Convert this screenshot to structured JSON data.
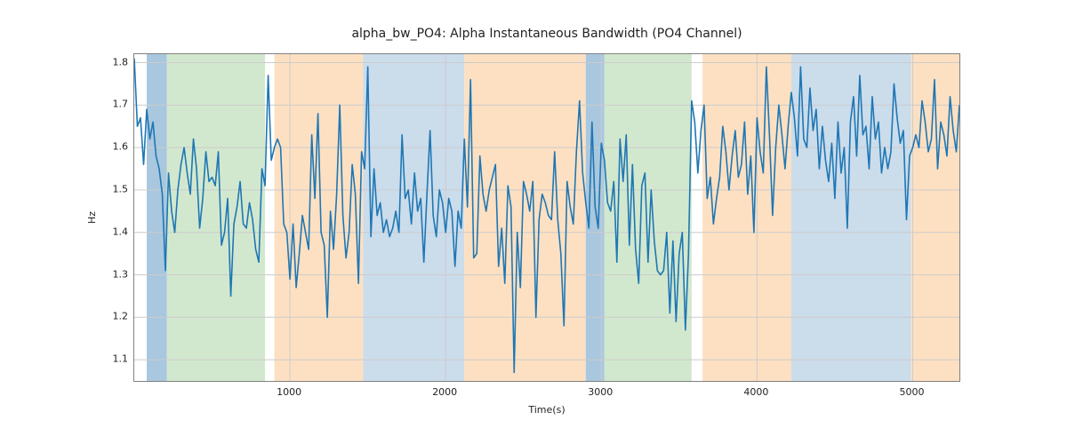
{
  "chart_data": {
    "type": "line",
    "title": "alpha_bw_PO4: Alpha Instantaneous Bandwidth (PO4 Channel)",
    "xlabel": "Time(s)",
    "ylabel": "Hz",
    "xlim": [
      0,
      5300
    ],
    "ylim": [
      1.05,
      1.82
    ],
    "xticks": [
      1000,
      2000,
      3000,
      4000,
      5000
    ],
    "yticks": [
      1.1,
      1.2,
      1.3,
      1.4,
      1.5,
      1.6,
      1.7,
      1.8
    ],
    "bands": [
      {
        "start": 80,
        "end": 210,
        "color": "blue-dark"
      },
      {
        "start": 210,
        "end": 840,
        "color": "green"
      },
      {
        "start": 900,
        "end": 1470,
        "color": "orange"
      },
      {
        "start": 1470,
        "end": 2120,
        "color": "blue"
      },
      {
        "start": 2120,
        "end": 2900,
        "color": "orange"
      },
      {
        "start": 2900,
        "end": 3020,
        "color": "blue-dark"
      },
      {
        "start": 3020,
        "end": 3580,
        "color": "green"
      },
      {
        "start": 3650,
        "end": 4220,
        "color": "orange"
      },
      {
        "start": 4220,
        "end": 4990,
        "color": "blue"
      },
      {
        "start": 4990,
        "end": 5300,
        "color": "orange"
      }
    ],
    "series": [
      {
        "name": "alpha_bw_PO4",
        "x": [
          0,
          20,
          40,
          60,
          80,
          100,
          120,
          140,
          160,
          180,
          200,
          220,
          240,
          260,
          280,
          300,
          320,
          340,
          360,
          380,
          400,
          420,
          440,
          460,
          480,
          500,
          520,
          540,
          560,
          580,
          600,
          620,
          640,
          660,
          680,
          700,
          720,
          740,
          760,
          780,
          800,
          820,
          840,
          860,
          880,
          900,
          920,
          940,
          960,
          980,
          1000,
          1020,
          1040,
          1060,
          1080,
          1100,
          1120,
          1140,
          1160,
          1180,
          1200,
          1220,
          1240,
          1260,
          1280,
          1300,
          1320,
          1340,
          1360,
          1380,
          1400,
          1420,
          1440,
          1460,
          1480,
          1500,
          1520,
          1540,
          1560,
          1580,
          1600,
          1620,
          1640,
          1660,
          1680,
          1700,
          1720,
          1740,
          1760,
          1780,
          1800,
          1820,
          1840,
          1860,
          1880,
          1900,
          1920,
          1940,
          1960,
          1980,
          2000,
          2020,
          2040,
          2060,
          2080,
          2100,
          2120,
          2140,
          2160,
          2180,
          2200,
          2220,
          2240,
          2260,
          2280,
          2300,
          2320,
          2340,
          2360,
          2380,
          2400,
          2420,
          2440,
          2460,
          2480,
          2500,
          2520,
          2540,
          2560,
          2580,
          2600,
          2620,
          2640,
          2660,
          2680,
          2700,
          2720,
          2740,
          2760,
          2780,
          2800,
          2820,
          2840,
          2860,
          2880,
          2900,
          2920,
          2940,
          2960,
          2980,
          3000,
          3020,
          3040,
          3060,
          3080,
          3100,
          3120,
          3140,
          3160,
          3180,
          3200,
          3220,
          3240,
          3260,
          3280,
          3300,
          3320,
          3340,
          3360,
          3380,
          3400,
          3420,
          3440,
          3460,
          3480,
          3500,
          3520,
          3540,
          3560,
          3580,
          3600,
          3620,
          3640,
          3660,
          3680,
          3700,
          3720,
          3740,
          3760,
          3780,
          3800,
          3820,
          3840,
          3860,
          3880,
          3900,
          3920,
          3940,
          3960,
          3980,
          4000,
          4020,
          4040,
          4060,
          4080,
          4100,
          4120,
          4140,
          4160,
          4180,
          4200,
          4220,
          4240,
          4260,
          4280,
          4300,
          4320,
          4340,
          4360,
          4380,
          4400,
          4420,
          4440,
          4460,
          4480,
          4500,
          4520,
          4540,
          4560,
          4580,
          4600,
          4620,
          4640,
          4660,
          4680,
          4700,
          4720,
          4740,
          4760,
          4780,
          4800,
          4820,
          4840,
          4860,
          4880,
          4900,
          4920,
          4940,
          4960,
          4980,
          5000,
          5020,
          5040,
          5060,
          5080,
          5100,
          5120,
          5140,
          5160,
          5180,
          5200,
          5220,
          5240,
          5260,
          5280,
          5300
        ],
        "y": [
          1.81,
          1.65,
          1.67,
          1.56,
          1.69,
          1.62,
          1.66,
          1.58,
          1.55,
          1.49,
          1.31,
          1.54,
          1.45,
          1.4,
          1.5,
          1.56,
          1.6,
          1.54,
          1.49,
          1.62,
          1.55,
          1.41,
          1.48,
          1.59,
          1.52,
          1.53,
          1.51,
          1.59,
          1.37,
          1.4,
          1.48,
          1.25,
          1.42,
          1.46,
          1.52,
          1.42,
          1.41,
          1.47,
          1.43,
          1.36,
          1.33,
          1.55,
          1.51,
          1.77,
          1.57,
          1.6,
          1.62,
          1.6,
          1.42,
          1.4,
          1.29,
          1.42,
          1.27,
          1.35,
          1.44,
          1.4,
          1.36,
          1.63,
          1.48,
          1.68,
          1.4,
          1.37,
          1.2,
          1.45,
          1.36,
          1.49,
          1.7,
          1.44,
          1.34,
          1.4,
          1.56,
          1.49,
          1.28,
          1.59,
          1.55,
          1.79,
          1.39,
          1.55,
          1.44,
          1.47,
          1.4,
          1.43,
          1.39,
          1.41,
          1.45,
          1.4,
          1.63,
          1.48,
          1.5,
          1.42,
          1.54,
          1.45,
          1.48,
          1.33,
          1.49,
          1.64,
          1.44,
          1.39,
          1.5,
          1.47,
          1.4,
          1.48,
          1.45,
          1.32,
          1.45,
          1.41,
          1.62,
          1.46,
          1.76,
          1.34,
          1.35,
          1.58,
          1.49,
          1.45,
          1.5,
          1.53,
          1.56,
          1.32,
          1.41,
          1.28,
          1.51,
          1.46,
          1.07,
          1.4,
          1.27,
          1.52,
          1.49,
          1.45,
          1.52,
          1.2,
          1.43,
          1.49,
          1.47,
          1.44,
          1.43,
          1.59,
          1.43,
          1.35,
          1.18,
          1.52,
          1.46,
          1.42,
          1.59,
          1.71,
          1.54,
          1.47,
          1.41,
          1.66,
          1.46,
          1.41,
          1.61,
          1.57,
          1.47,
          1.45,
          1.52,
          1.33,
          1.62,
          1.52,
          1.63,
          1.37,
          1.56,
          1.36,
          1.28,
          1.51,
          1.54,
          1.33,
          1.5,
          1.38,
          1.31,
          1.3,
          1.31,
          1.4,
          1.21,
          1.38,
          1.19,
          1.35,
          1.4,
          1.17,
          1.35,
          1.71,
          1.66,
          1.54,
          1.64,
          1.7,
          1.48,
          1.53,
          1.42,
          1.48,
          1.53,
          1.65,
          1.59,
          1.5,
          1.58,
          1.64,
          1.53,
          1.56,
          1.66,
          1.49,
          1.58,
          1.4,
          1.67,
          1.59,
          1.54,
          1.79,
          1.63,
          1.44,
          1.6,
          1.7,
          1.63,
          1.55,
          1.65,
          1.73,
          1.67,
          1.58,
          1.79,
          1.62,
          1.6,
          1.74,
          1.64,
          1.69,
          1.55,
          1.65,
          1.57,
          1.52,
          1.61,
          1.48,
          1.66,
          1.54,
          1.6,
          1.41,
          1.66,
          1.72,
          1.58,
          1.77,
          1.63,
          1.65,
          1.55,
          1.72,
          1.62,
          1.66,
          1.54,
          1.6,
          1.55,
          1.59,
          1.75,
          1.67,
          1.61,
          1.64,
          1.43,
          1.58,
          1.6,
          1.63,
          1.6,
          1.71,
          1.66,
          1.59,
          1.62,
          1.76,
          1.55,
          1.66,
          1.63,
          1.58,
          1.72,
          1.64,
          1.59,
          1.7
        ]
      }
    ]
  }
}
